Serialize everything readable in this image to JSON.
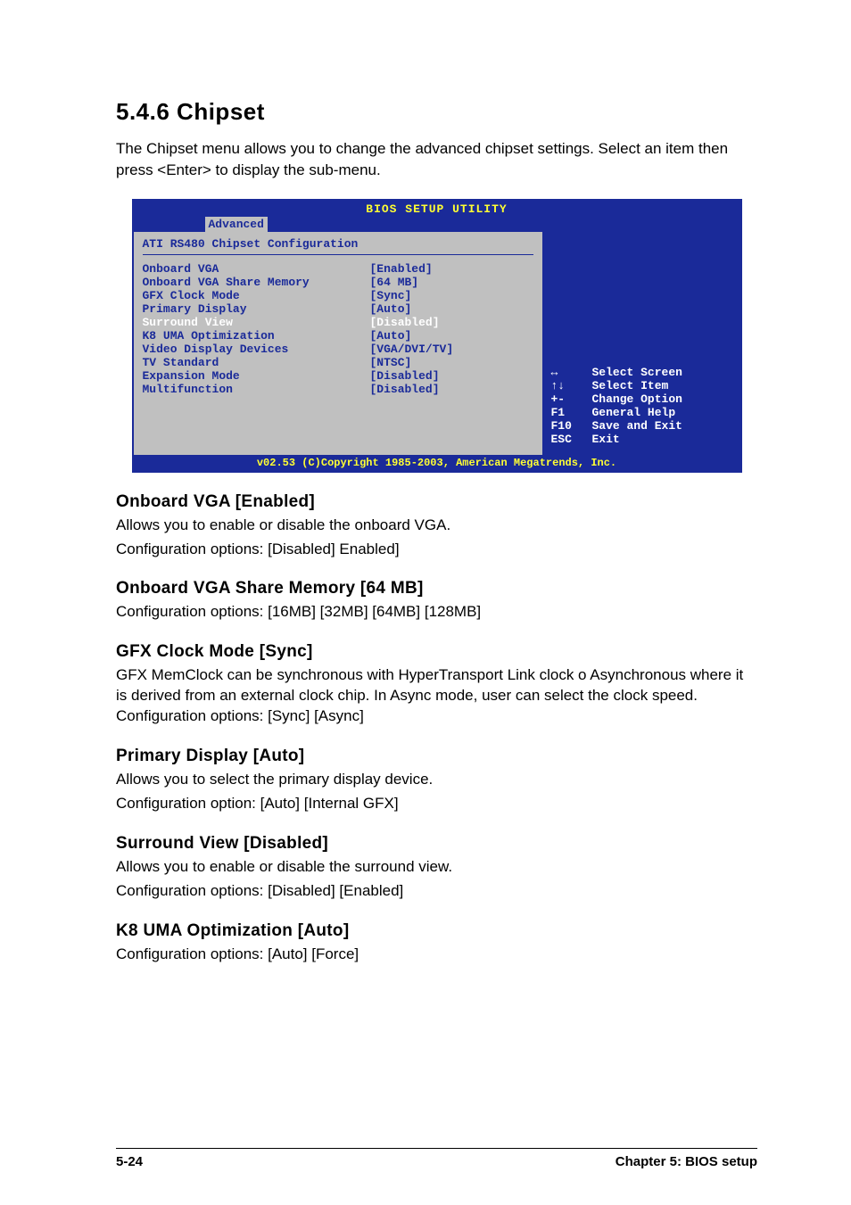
{
  "heading": "5.4.6   Chipset",
  "intro": "The Chipset menu allows you to change the advanced chipset settings. Select an item then press <Enter> to display the sub-menu.",
  "bios": {
    "title": "BIOS SETUP UTILITY",
    "tab": "Advanced",
    "section": "ATI RS480 Chipset Configuration",
    "items": [
      {
        "label": "Onboard VGA",
        "value": "[Enabled]",
        "hl": false
      },
      {
        "label": "Onboard VGA Share Memory",
        "value": "[64 MB]",
        "hl": false
      },
      {
        "label": "GFX Clock Mode",
        "value": "[Sync]",
        "hl": false
      },
      {
        "label": "Primary Display",
        "value": "[Auto]",
        "hl": false
      },
      {
        "label": "Surround View",
        "value": "[Disabled]",
        "hl": true
      },
      {
        "label": "K8 UMA Optimization",
        "value": "[Auto]",
        "hl": false
      },
      {
        "label": "Video Display Devices",
        "value": "[VGA/DVI/TV]",
        "hl": false
      },
      {
        "label": "TV Standard",
        "value": "[NTSC]",
        "hl": false
      },
      {
        "label": "Expansion Mode",
        "value": "[Disabled]",
        "hl": false
      },
      {
        "label": "Multifunction",
        "value": "[Disabled]",
        "hl": false
      }
    ],
    "help": [
      {
        "key": "↔",
        "text": "Select Screen"
      },
      {
        "key": "↑↓",
        "text": "Select Item"
      },
      {
        "key": "+-",
        "text": "Change Option"
      },
      {
        "key": "F1",
        "text": "General Help"
      },
      {
        "key": "F10",
        "text": "Save and Exit"
      },
      {
        "key": "ESC",
        "text": "Exit"
      }
    ],
    "footer": "v02.53 (C)Copyright 1985-2003, American Megatrends, Inc."
  },
  "sections": [
    {
      "title": "Onboard VGA [Enabled]",
      "body": "Allows you to enable or disable the onboard VGA.\nConfiguration options: [Disabled] Enabled]"
    },
    {
      "title": "Onboard VGA Share Memory [64 MB]",
      "body": "Configuration options: [16MB] [32MB] [64MB] [128MB]"
    },
    {
      "title": "GFX Clock Mode [Sync]",
      "body": "GFX MemClock can be synchronous with HyperTransport Link clock o Asynchronous where it is derived from an external clock chip. In Async mode, user can select the clock speed. Configuration options: [Sync] [Async]"
    },
    {
      "title": "Primary Display [Auto]",
      "body": "Allows you to select the primary display device.\nConfiguration option: [Auto] [Internal GFX]"
    },
    {
      "title": "Surround View [Disabled]",
      "body": "Allows you to enable or disable the surround view.\nConfiguration options: [Disabled] [Enabled]"
    },
    {
      "title": "K8 UMA Optimization [Auto]",
      "body": "Configuration options: [Auto] [Force]"
    }
  ],
  "footer": {
    "left": "5-24",
    "right": "Chapter 5: BIOS setup"
  }
}
